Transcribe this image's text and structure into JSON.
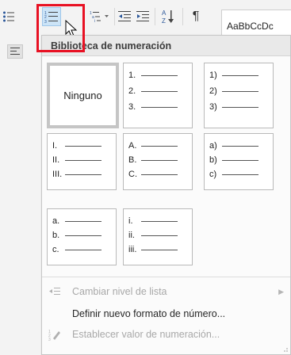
{
  "ribbon": {
    "style_preview": "AaBbCcDc",
    "sort_icon_letters": "A\nZ",
    "pilcrow": "¶"
  },
  "gallery": {
    "title": "Biblioteca de numeración",
    "tiles": [
      {
        "type": "none",
        "label": "Ninguno"
      },
      {
        "type": "list",
        "items": [
          "1.",
          "2.",
          "3."
        ]
      },
      {
        "type": "list",
        "items": [
          "1)",
          "2)",
          "3)"
        ]
      },
      {
        "type": "list",
        "items": [
          "I.",
          "II.",
          "III."
        ]
      },
      {
        "type": "list",
        "items": [
          "A.",
          "B.",
          "C."
        ]
      },
      {
        "type": "list",
        "items": [
          "a)",
          "b)",
          "c)"
        ]
      },
      {
        "type": "list",
        "items": [
          "a.",
          "b.",
          "c."
        ]
      },
      {
        "type": "list",
        "items": [
          "i.",
          "ii.",
          "iii."
        ]
      }
    ]
  },
  "menu": {
    "change_level": "Cambiar nivel de lista",
    "define_format": "Definir nuevo formato de número...",
    "set_value": "Establecer valor de numeración..."
  }
}
